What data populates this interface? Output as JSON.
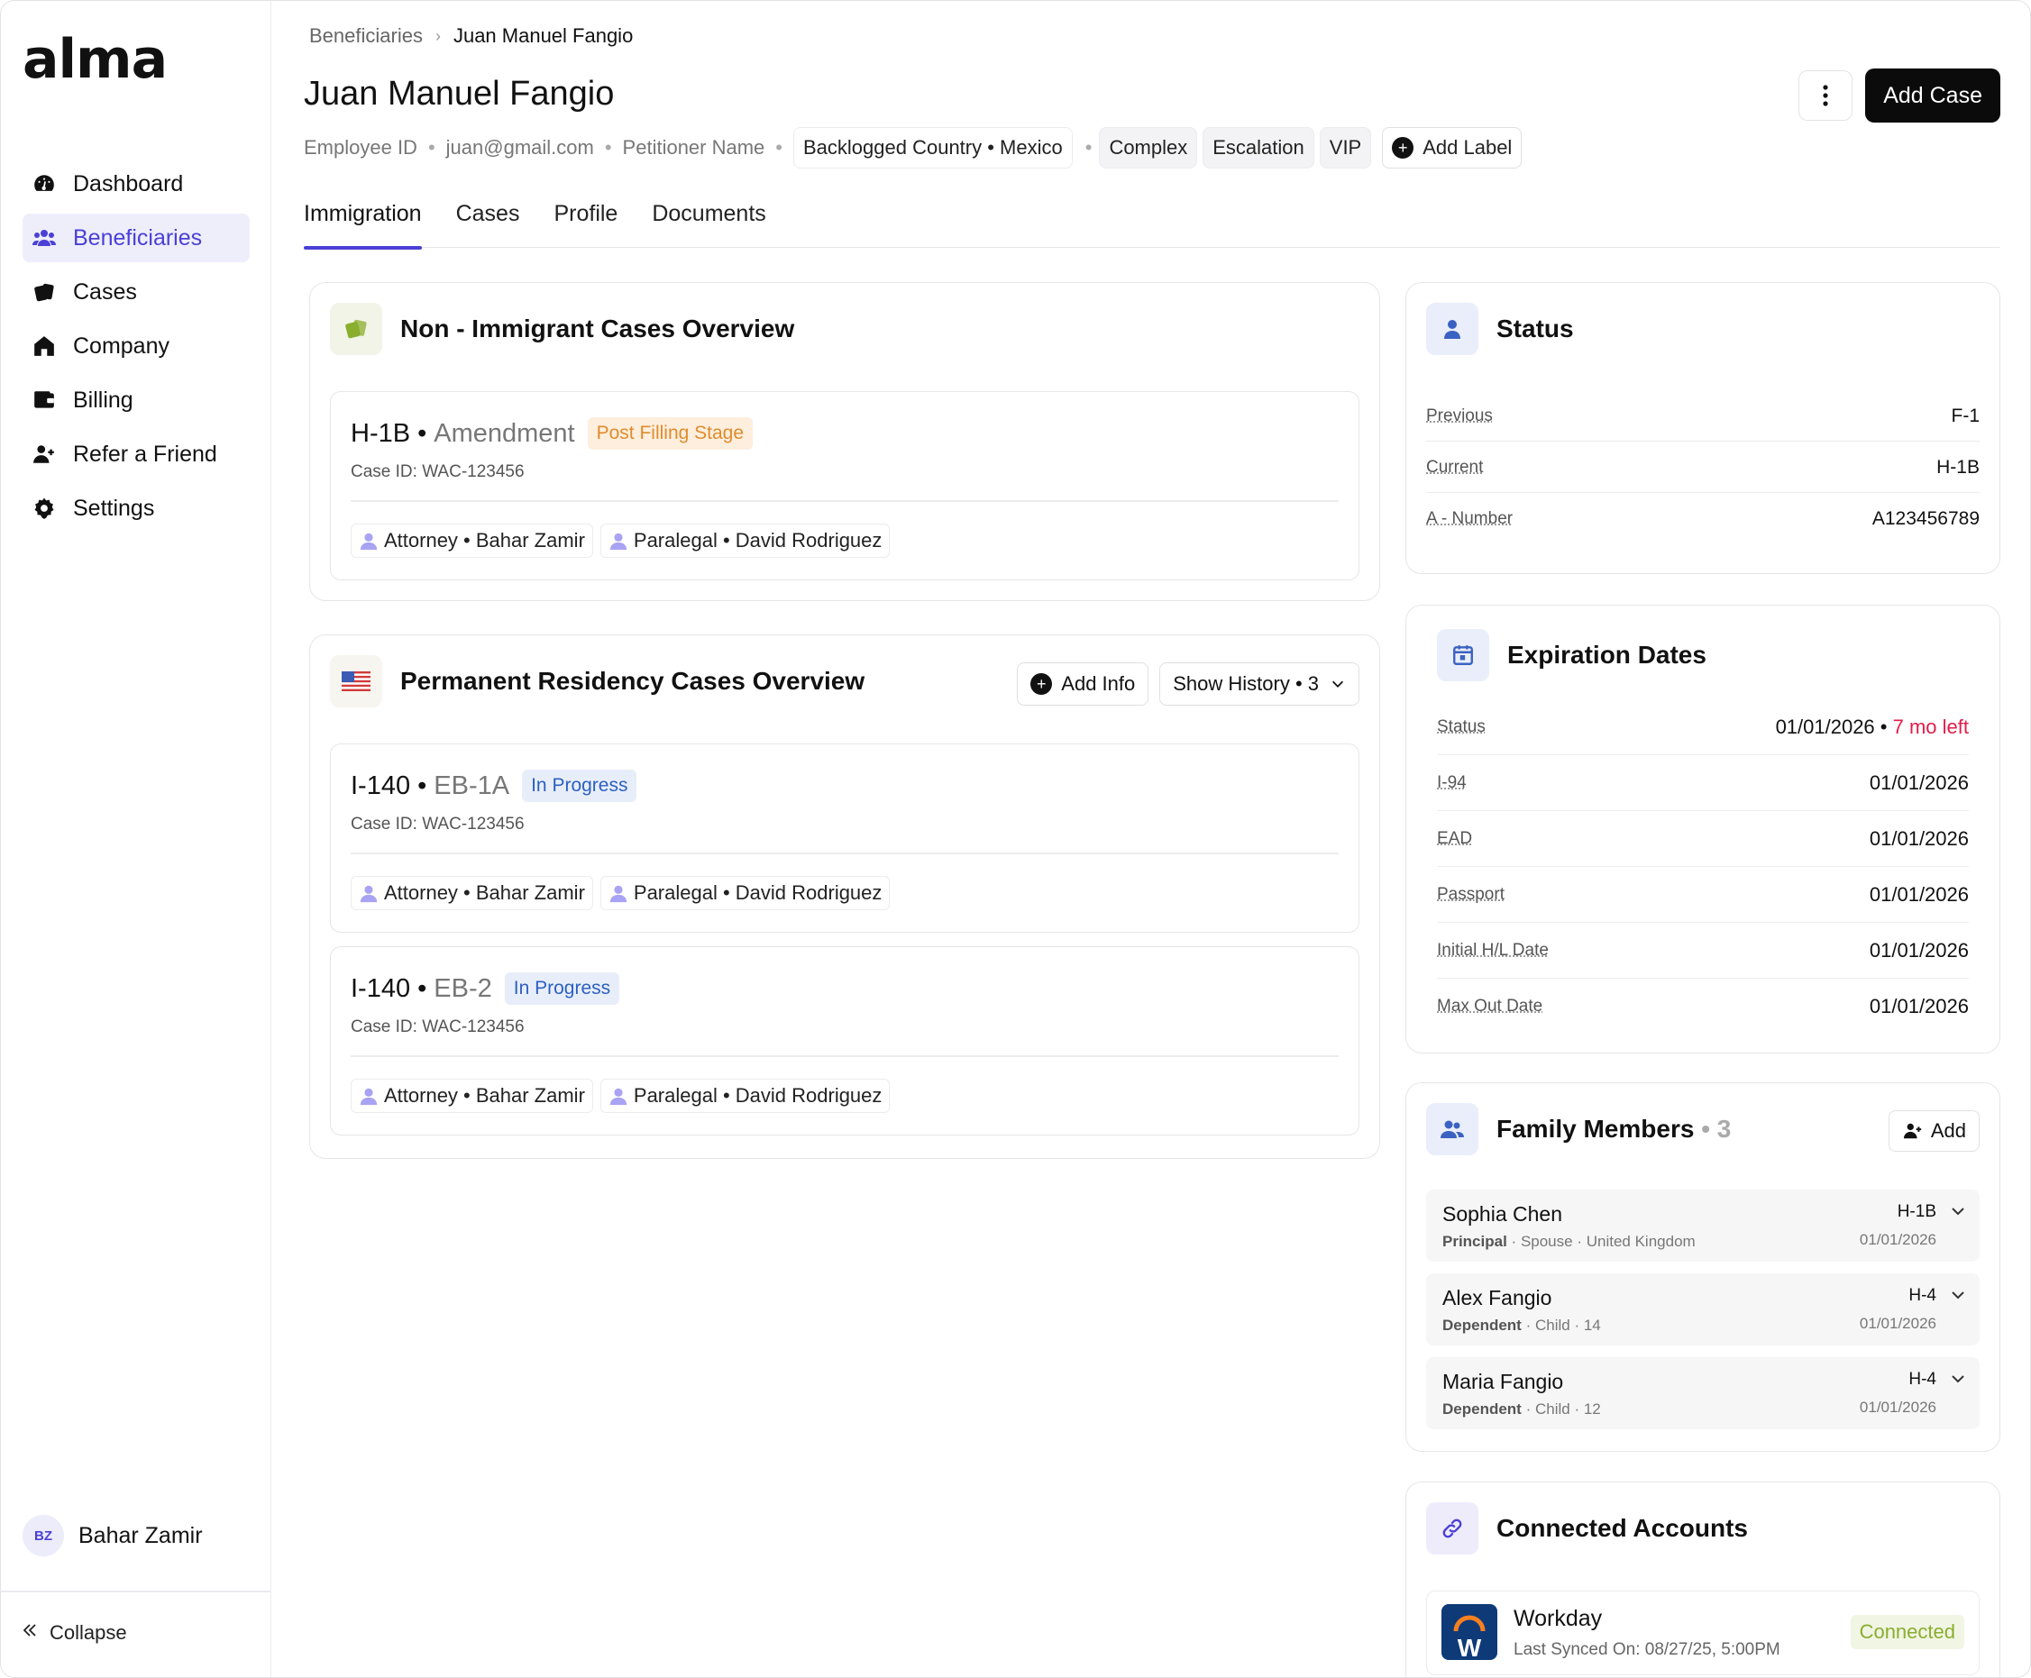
{
  "app": {
    "logo": "alma"
  },
  "sidebar": {
    "items": [
      {
        "label": "Dashboard",
        "icon": "dashboard-icon"
      },
      {
        "label": "Beneficiaries",
        "icon": "users-icon"
      },
      {
        "label": "Cases",
        "icon": "cases-icon"
      },
      {
        "label": "Company",
        "icon": "home-icon"
      },
      {
        "label": "Billing",
        "icon": "wallet-icon"
      },
      {
        "label": "Refer a Friend",
        "icon": "user-plus-icon"
      },
      {
        "label": "Settings",
        "icon": "gear-icon"
      }
    ],
    "active": "Beneficiaries",
    "user": {
      "initials": "BZ",
      "name": "Bahar Zamir"
    },
    "collapse_label": "Collapse"
  },
  "breadcrumb": {
    "parent": "Beneficiaries",
    "current": "Juan Manuel Fangio"
  },
  "header": {
    "title": "Juan Manuel Fangio",
    "add_case_label": "Add Case",
    "meta": [
      "Employee ID",
      "juan@gmail.com",
      "Petitioner Name"
    ],
    "country_chip": "Backlogged Country • Mexico",
    "labels": [
      "Complex",
      "Escalation",
      "VIP"
    ],
    "add_label": "Add Label"
  },
  "tabs": [
    "Immigration",
    "Cases",
    "Profile",
    "Documents"
  ],
  "non_immigrant": {
    "title": "Non - Immigrant Cases Overview",
    "cases": [
      {
        "type": "H-1B",
        "sub": "Amendment",
        "stage": "Post Filling Stage",
        "case_id": "Case ID: WAC-123456",
        "attorney": "Attorney • Bahar Zamir",
        "paralegal": "Paralegal • David Rodriguez"
      }
    ]
  },
  "permanent": {
    "title": "Permanent Residency Cases Overview",
    "add_info_label": "Add Info",
    "history_label": "Show History • 3",
    "cases": [
      {
        "type": "I-140",
        "sub": "EB-1A",
        "stage": "In Progress",
        "case_id": "Case ID: WAC-123456",
        "attorney": "Attorney • Bahar Zamir",
        "paralegal": "Paralegal • David Rodriguez"
      },
      {
        "type": "I-140",
        "sub": "EB-2",
        "stage": "In Progress",
        "case_id": "Case ID: WAC-123456",
        "attorney": "Attorney • Bahar Zamir",
        "paralegal": "Paralegal • David Rodriguez"
      }
    ]
  },
  "status": {
    "title": "Status",
    "rows": [
      {
        "label": "Previous",
        "value": "F-1"
      },
      {
        "label": "Current",
        "value": "H-1B"
      },
      {
        "label": "A - Number",
        "value": "A123456789"
      }
    ]
  },
  "expiration": {
    "title": "Expiration Dates",
    "status_label": "Status",
    "status_date": "01/01/2026",
    "status_left": "7 mo left",
    "rows": [
      {
        "label": "I-94",
        "value": "01/01/2026"
      },
      {
        "label": "EAD",
        "value": "01/01/2026"
      },
      {
        "label": "Passport",
        "value": "01/01/2026"
      },
      {
        "label": "Initial H/L Date",
        "value": "01/01/2026"
      },
      {
        "label": "Max Out Date",
        "value": "01/01/2026"
      }
    ]
  },
  "family": {
    "title": "Family Members",
    "count": "3",
    "add_label": "Add",
    "members": [
      {
        "name": "Sophia Chen",
        "role": "Principal",
        "relation": "Spouse",
        "extra": "United Kingdom",
        "visa": "H-1B",
        "date": "01/01/2026"
      },
      {
        "name": "Alex Fangio",
        "role": "Dependent",
        "relation": "Child",
        "extra": "14",
        "visa": "H-4",
        "date": "01/01/2026"
      },
      {
        "name": "Maria Fangio",
        "role": "Dependent",
        "relation": "Child",
        "extra": "12",
        "visa": "H-4",
        "date": "01/01/2026"
      }
    ]
  },
  "connected": {
    "title": "Connected Accounts",
    "account": {
      "name": "Workday",
      "synced": "Last Synced On: 08/27/25, 5:00PM",
      "status": "Connected"
    }
  },
  "colors": {
    "accent": "#4a40d6",
    "orange": "#e08c2d",
    "blue": "#2c60c1",
    "red": "#e21d48",
    "green": "#8aae2e"
  }
}
